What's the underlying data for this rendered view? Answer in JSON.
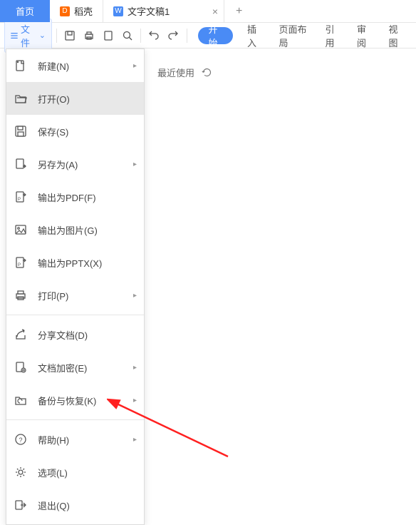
{
  "tabs": {
    "home": "首页",
    "shell": "稻壳",
    "doc": "文字文稿1",
    "new": "+"
  },
  "toolbar": {
    "file_button": "文件"
  },
  "ribbon": {
    "start": "开始",
    "insert": "插入",
    "page_layout": "页面布局",
    "references": "引用",
    "review": "审阅",
    "view": "视图"
  },
  "file_menu": {
    "new": "新建(N)",
    "open": "打开(O)",
    "save": "保存(S)",
    "save_as": "另存为(A)",
    "export_pdf": "输出为PDF(F)",
    "export_image": "输出为图片(G)",
    "export_pptx": "输出为PPTX(X)",
    "print": "打印(P)",
    "share": "分享文档(D)",
    "encrypt": "文档加密(E)",
    "backup": "备份与恢复(K)",
    "help": "帮助(H)",
    "options": "选项(L)",
    "exit": "退出(Q)"
  },
  "recent": {
    "header": "最近使用"
  },
  "glyphs": {
    "close": "×",
    "arrow_right": "▸",
    "dropdown": "⌄"
  }
}
